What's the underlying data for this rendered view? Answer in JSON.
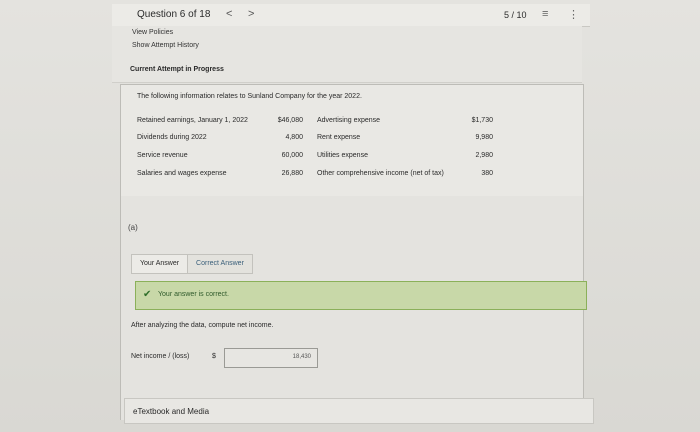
{
  "header": {
    "question_label": "Question 6 of 18",
    "prev_symbol": "<",
    "next_symbol": ">",
    "page_info": "5 / 10",
    "list_icon": "list-icon",
    "more_icon": "more-icon"
  },
  "links": {
    "view_policies": "View Policies",
    "show_history": "Show Attempt History",
    "current_attempt": "Current Attempt in Progress"
  },
  "question": {
    "intro": "The following information relates to Sunland Company for the year 2022.",
    "left_rows": [
      {
        "label": "Retained earnings, January 1, 2022",
        "value": "$46,080"
      },
      {
        "label": "Dividends during 2022",
        "value": "4,800"
      },
      {
        "label": "Service revenue",
        "value": "60,000"
      },
      {
        "label": "Salaries and wages expense",
        "value": "26,880"
      }
    ],
    "right_rows": [
      {
        "label": "Advertising expense",
        "value": "$1,730"
      },
      {
        "label": "Rent expense",
        "value": "9,980"
      },
      {
        "label": "Utilities expense",
        "value": "2,980"
      },
      {
        "label": "Other comprehensive income (net of tax)",
        "value": "380"
      }
    ]
  },
  "part": {
    "label": "(a)",
    "tab_your": "Your Answer",
    "tab_correct": "Correct Answer",
    "correct_msg": "Your answer is correct.",
    "prompt": "After analyzing the data, compute net income.",
    "ni_label": "Net income / (loss)",
    "dollar": "$",
    "ni_value": "18,430"
  },
  "footer": {
    "etext": "eTextbook and Media"
  },
  "colors": {
    "success_bg": "#c8d8a8",
    "success_border": "#8bb05a",
    "check": "#2f6f2a"
  }
}
